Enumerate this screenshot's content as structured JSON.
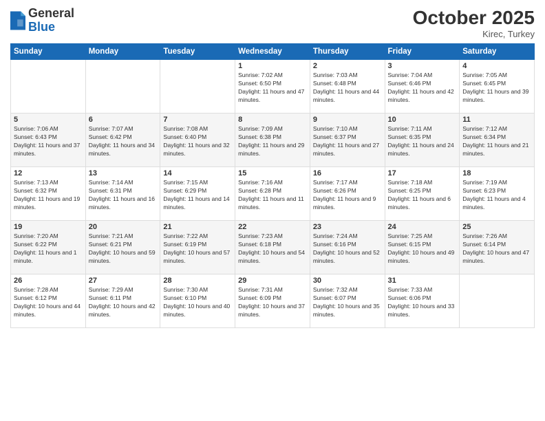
{
  "header": {
    "logo": {
      "general": "General",
      "blue": "Blue"
    },
    "title": "October 2025",
    "location": "Kirec, Turkey"
  },
  "days_of_week": [
    "Sunday",
    "Monday",
    "Tuesday",
    "Wednesday",
    "Thursday",
    "Friday",
    "Saturday"
  ],
  "weeks": [
    [
      {
        "num": "",
        "info": ""
      },
      {
        "num": "",
        "info": ""
      },
      {
        "num": "",
        "info": ""
      },
      {
        "num": "1",
        "info": "Sunrise: 7:02 AM\nSunset: 6:50 PM\nDaylight: 11 hours and 47 minutes."
      },
      {
        "num": "2",
        "info": "Sunrise: 7:03 AM\nSunset: 6:48 PM\nDaylight: 11 hours and 44 minutes."
      },
      {
        "num": "3",
        "info": "Sunrise: 7:04 AM\nSunset: 6:46 PM\nDaylight: 11 hours and 42 minutes."
      },
      {
        "num": "4",
        "info": "Sunrise: 7:05 AM\nSunset: 6:45 PM\nDaylight: 11 hours and 39 minutes."
      }
    ],
    [
      {
        "num": "5",
        "info": "Sunrise: 7:06 AM\nSunset: 6:43 PM\nDaylight: 11 hours and 37 minutes."
      },
      {
        "num": "6",
        "info": "Sunrise: 7:07 AM\nSunset: 6:42 PM\nDaylight: 11 hours and 34 minutes."
      },
      {
        "num": "7",
        "info": "Sunrise: 7:08 AM\nSunset: 6:40 PM\nDaylight: 11 hours and 32 minutes."
      },
      {
        "num": "8",
        "info": "Sunrise: 7:09 AM\nSunset: 6:38 PM\nDaylight: 11 hours and 29 minutes."
      },
      {
        "num": "9",
        "info": "Sunrise: 7:10 AM\nSunset: 6:37 PM\nDaylight: 11 hours and 27 minutes."
      },
      {
        "num": "10",
        "info": "Sunrise: 7:11 AM\nSunset: 6:35 PM\nDaylight: 11 hours and 24 minutes."
      },
      {
        "num": "11",
        "info": "Sunrise: 7:12 AM\nSunset: 6:34 PM\nDaylight: 11 hours and 21 minutes."
      }
    ],
    [
      {
        "num": "12",
        "info": "Sunrise: 7:13 AM\nSunset: 6:32 PM\nDaylight: 11 hours and 19 minutes."
      },
      {
        "num": "13",
        "info": "Sunrise: 7:14 AM\nSunset: 6:31 PM\nDaylight: 11 hours and 16 minutes."
      },
      {
        "num": "14",
        "info": "Sunrise: 7:15 AM\nSunset: 6:29 PM\nDaylight: 11 hours and 14 minutes."
      },
      {
        "num": "15",
        "info": "Sunrise: 7:16 AM\nSunset: 6:28 PM\nDaylight: 11 hours and 11 minutes."
      },
      {
        "num": "16",
        "info": "Sunrise: 7:17 AM\nSunset: 6:26 PM\nDaylight: 11 hours and 9 minutes."
      },
      {
        "num": "17",
        "info": "Sunrise: 7:18 AM\nSunset: 6:25 PM\nDaylight: 11 hours and 6 minutes."
      },
      {
        "num": "18",
        "info": "Sunrise: 7:19 AM\nSunset: 6:23 PM\nDaylight: 11 hours and 4 minutes."
      }
    ],
    [
      {
        "num": "19",
        "info": "Sunrise: 7:20 AM\nSunset: 6:22 PM\nDaylight: 11 hours and 1 minute."
      },
      {
        "num": "20",
        "info": "Sunrise: 7:21 AM\nSunset: 6:21 PM\nDaylight: 10 hours and 59 minutes."
      },
      {
        "num": "21",
        "info": "Sunrise: 7:22 AM\nSunset: 6:19 PM\nDaylight: 10 hours and 57 minutes."
      },
      {
        "num": "22",
        "info": "Sunrise: 7:23 AM\nSunset: 6:18 PM\nDaylight: 10 hours and 54 minutes."
      },
      {
        "num": "23",
        "info": "Sunrise: 7:24 AM\nSunset: 6:16 PM\nDaylight: 10 hours and 52 minutes."
      },
      {
        "num": "24",
        "info": "Sunrise: 7:25 AM\nSunset: 6:15 PM\nDaylight: 10 hours and 49 minutes."
      },
      {
        "num": "25",
        "info": "Sunrise: 7:26 AM\nSunset: 6:14 PM\nDaylight: 10 hours and 47 minutes."
      }
    ],
    [
      {
        "num": "26",
        "info": "Sunrise: 7:28 AM\nSunset: 6:12 PM\nDaylight: 10 hours and 44 minutes."
      },
      {
        "num": "27",
        "info": "Sunrise: 7:29 AM\nSunset: 6:11 PM\nDaylight: 10 hours and 42 minutes."
      },
      {
        "num": "28",
        "info": "Sunrise: 7:30 AM\nSunset: 6:10 PM\nDaylight: 10 hours and 40 minutes."
      },
      {
        "num": "29",
        "info": "Sunrise: 7:31 AM\nSunset: 6:09 PM\nDaylight: 10 hours and 37 minutes."
      },
      {
        "num": "30",
        "info": "Sunrise: 7:32 AM\nSunset: 6:07 PM\nDaylight: 10 hours and 35 minutes."
      },
      {
        "num": "31",
        "info": "Sunrise: 7:33 AM\nSunset: 6:06 PM\nDaylight: 10 hours and 33 minutes."
      },
      {
        "num": "",
        "info": ""
      }
    ]
  ]
}
